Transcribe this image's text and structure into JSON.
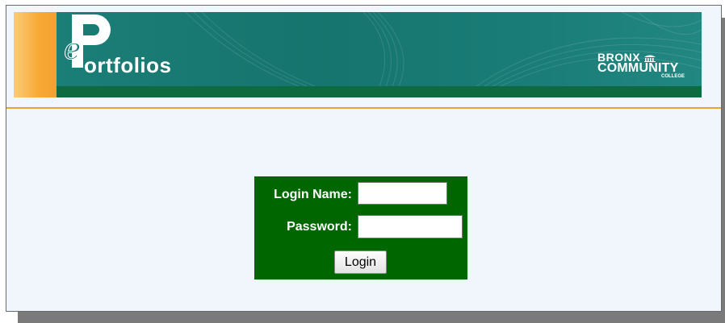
{
  "header": {
    "app_logo_letter": "e",
    "app_logo_word": "ortfolios",
    "institution": {
      "line1": "BRONX",
      "line2": "COMMUNITY",
      "line3": "COLLEGE"
    },
    "colors": {
      "banner_teal": "#197b74",
      "accent_yellow": "#f8a935",
      "banner_bar_green": "#0e6a3f",
      "divider_gold": "#e0a63a"
    }
  },
  "login_form": {
    "login_name_label": "Login Name:",
    "login_name_value": "",
    "password_label": "Password:",
    "password_value": "",
    "submit_label": "Login",
    "background_color": "#006600"
  }
}
